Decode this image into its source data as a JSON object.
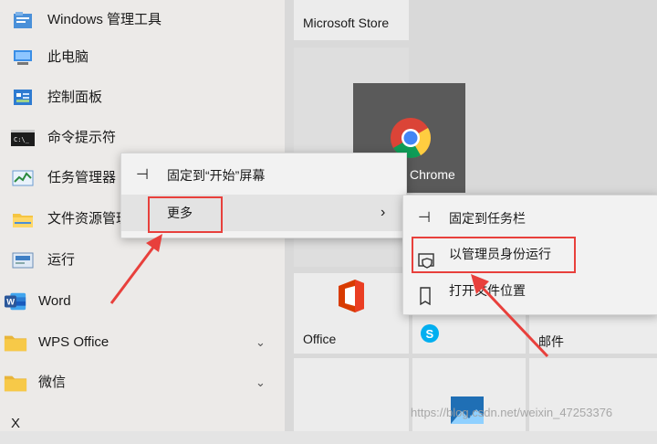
{
  "start_list": {
    "items": [
      {
        "label": "Windows 管理工具"
      },
      {
        "label": "此电脑"
      },
      {
        "label": "控制面板"
      },
      {
        "label": "命令提示符"
      },
      {
        "label": "任务管理器"
      },
      {
        "label": "文件资源管理"
      },
      {
        "label": "运行"
      },
      {
        "label": "Word"
      },
      {
        "label": "WPS Office"
      },
      {
        "label": "微信"
      },
      {
        "label": "X"
      }
    ]
  },
  "tiles": {
    "store_label": "Microsoft Store",
    "chrome_label": "Chrome",
    "office_label": "Office",
    "mail_label": "邮件"
  },
  "context_menu": {
    "pin_start_label": "固定到“开始”屏幕",
    "more_label": "更多",
    "submenu": {
      "pin_taskbar_label": "固定到任务栏",
      "run_as_admin_label": "以管理员身份运行",
      "open_location_label": "打开文件位置"
    }
  },
  "watermark": "https://blog.csdn.net/weixin_47253376",
  "colors": {
    "annotation_red": "#e8403c",
    "chrome_tile": "#5a5a5a",
    "word_blue": "#2b579a",
    "office_red": "#d83b01"
  }
}
